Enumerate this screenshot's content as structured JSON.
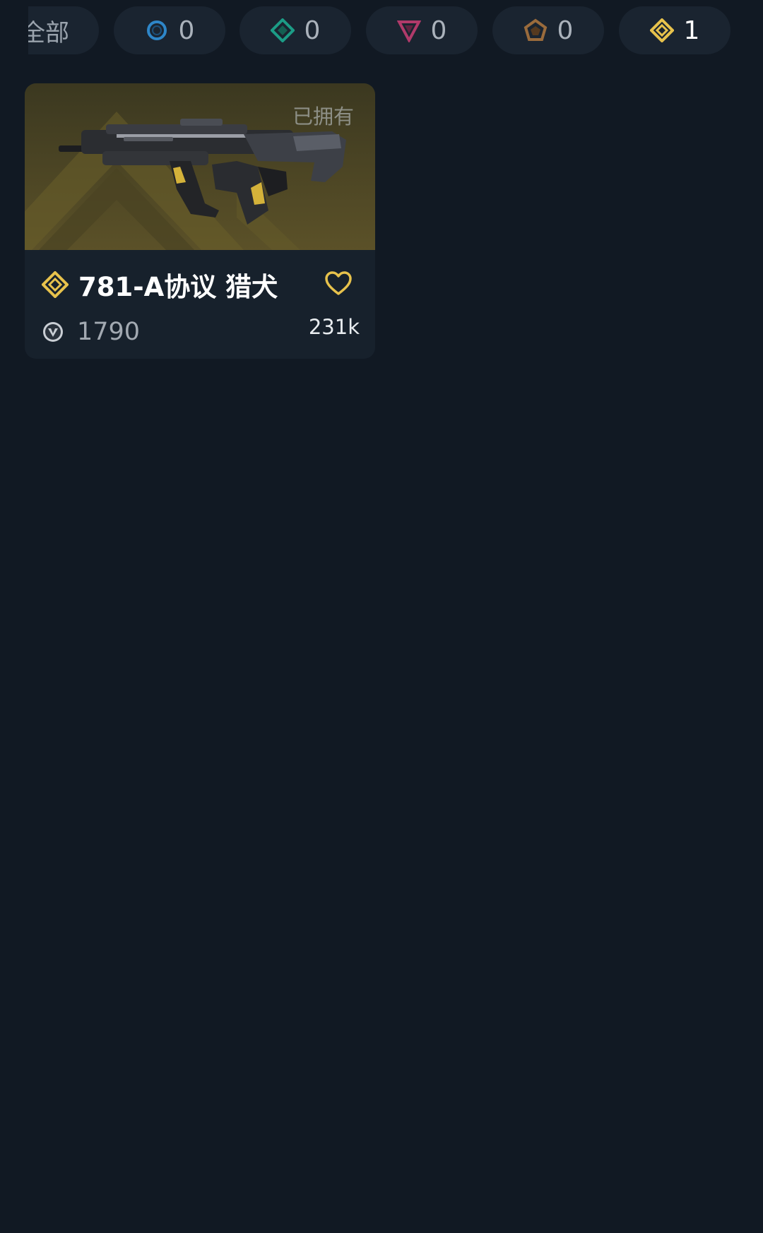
{
  "filters": {
    "all_label": "全部",
    "chips": [
      {
        "tier": "select",
        "count": "0",
        "color": "#2e86c8"
      },
      {
        "tier": "deluxe",
        "count": "0",
        "color": "#1c9c86"
      },
      {
        "tier": "premium",
        "count": "0",
        "color": "#b03a6a"
      },
      {
        "tier": "exclusive",
        "count": "0",
        "color": "#9a6b3c"
      },
      {
        "tier": "ultra",
        "count": "1",
        "color": "#e7c24c"
      }
    ]
  },
  "skin_card": {
    "owned_label": "已拥有",
    "name": "781-A协议 猎犬",
    "price": "1790",
    "likes": "231k",
    "tier_color": "#e7c24c"
  }
}
